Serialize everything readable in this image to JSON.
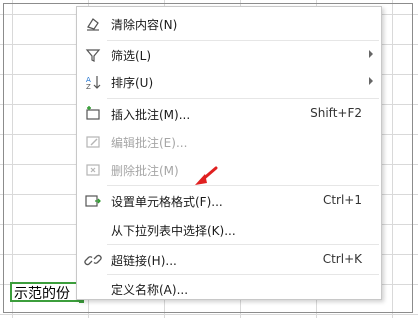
{
  "active_cell": {
    "text": "示范的份"
  },
  "menu": {
    "clear": {
      "label": "清除内容(N)"
    },
    "filter": {
      "label": "筛选(L)"
    },
    "sort": {
      "label": "排序(U)"
    },
    "insert_comment": {
      "label": "插入批注(M)...",
      "shortcut": "Shift+F2"
    },
    "edit_comment": {
      "label": "编辑批注(E)..."
    },
    "delete_comment": {
      "label": "删除批注(M)"
    },
    "format_cells": {
      "label": "设置单元格格式(F)...",
      "shortcut": "Ctrl+1"
    },
    "pick_list": {
      "label": "从下拉列表中选择(K)..."
    },
    "hyperlink": {
      "label": "超链接(H)...",
      "shortcut": "Ctrl+K"
    },
    "define_name": {
      "label": "定义名称(A)..."
    }
  },
  "colors": {
    "accent_green": "#3c9e3c",
    "annotation_red": "#e02020",
    "disabled_text": "#a6a6a6"
  },
  "icons": [
    "eraser-icon",
    "filter-icon",
    "sort-az-icon",
    "insert-comment-icon",
    "edit-comment-icon",
    "delete-comment-icon",
    "format-cells-icon",
    "link-icon"
  ]
}
